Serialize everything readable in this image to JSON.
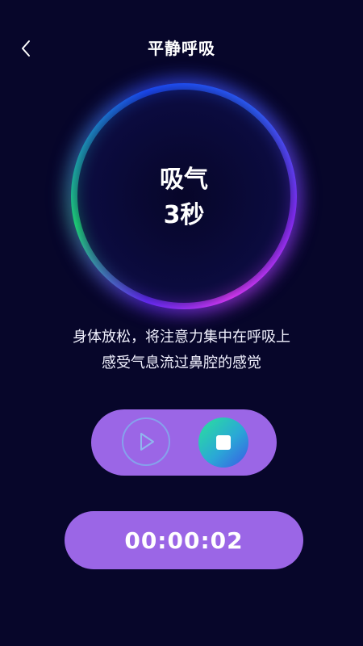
{
  "header": {
    "title": "平静呼吸",
    "back_icon": "chevron-left-icon"
  },
  "orb": {
    "phase": "吸气",
    "seconds": "3秒",
    "colors": {
      "green": "#1fe07a",
      "blue": "#1b4dff",
      "purple": "#8a2eff",
      "magenta": "#e43cff"
    }
  },
  "instruction": {
    "line1": "身体放松，将注意力集中在呼吸上",
    "line2": "感受气息流过鼻腔的感觉"
  },
  "controls": {
    "play_icon": "play-icon",
    "stop_icon": "stop-icon",
    "panel_color": "#9b66e6"
  },
  "timer": {
    "value": "00:00:02"
  },
  "theme": {
    "background": "#07062a",
    "accent": "#9b66e6"
  }
}
